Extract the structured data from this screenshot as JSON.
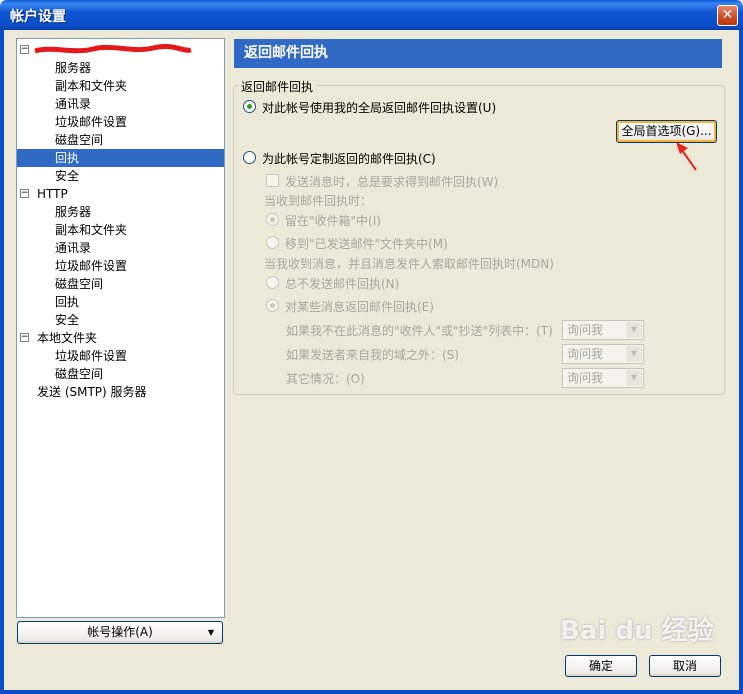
{
  "window": {
    "title": "帐户设置",
    "close_glyph": "✕"
  },
  "tree": {
    "account_collapse": "−",
    "items": [
      {
        "label": "服务器"
      },
      {
        "label": "副本和文件夹"
      },
      {
        "label": "通讯录"
      },
      {
        "label": "垃圾邮件设置"
      },
      {
        "label": "磁盘空间"
      },
      {
        "label": "回执"
      },
      {
        "label": "安全"
      },
      {
        "label": "HTTP"
      },
      {
        "label": "服务器"
      },
      {
        "label": "副本和文件夹"
      },
      {
        "label": "通讯录"
      },
      {
        "label": "垃圾邮件设置"
      },
      {
        "label": "磁盘空间"
      },
      {
        "label": "回执"
      },
      {
        "label": "安全"
      },
      {
        "label": "本地文件夹"
      },
      {
        "label": "垃圾邮件设置"
      },
      {
        "label": "磁盘空间"
      },
      {
        "label": "发送 (SMTP) 服务器"
      }
    ],
    "selected_index": 5
  },
  "account_actions": {
    "label": "帐号操作(A)",
    "arrow": "▼"
  },
  "pane": {
    "header": "返回邮件回执",
    "group_title": "返回邮件回执",
    "radio_global": "对此帐号使用我的全局返回邮件回执设置(U)",
    "global_prefs_button": "全局首选项(G)...",
    "radio_custom": "为此帐号定制返回的邮件回执(C)",
    "always_request": "发送消息时，总是要求得到邮件回执(W)",
    "when_receive": "当收到邮件回执时：",
    "leave_inbox": "留在\"收件箱\"中(I)",
    "move_sent": "移到\"已发送邮件\"文件夹中(M)",
    "when_request": "当我收到消息，并且消息发件人索取邮件回执时(MDN)",
    "never_send": "总不发送邮件回执(N)",
    "some_messages": "对某些消息返回邮件回执(E)",
    "not_in_to_cc": "如果我不在此消息的\"收件人\"或\"抄送\"列表中：(T)",
    "outside_domain": "如果发送者来自我的域之外：(S)",
    "other_cases": "其它情况：(O)",
    "ask_me": "询问我"
  },
  "footer": {
    "ok": "确定",
    "cancel": "取消"
  },
  "watermark": "Bai du 经验",
  "colors": {
    "selection": "#316ac5",
    "titlebar": "#0a4dc9",
    "annotation_arrow": "#e8231c"
  }
}
